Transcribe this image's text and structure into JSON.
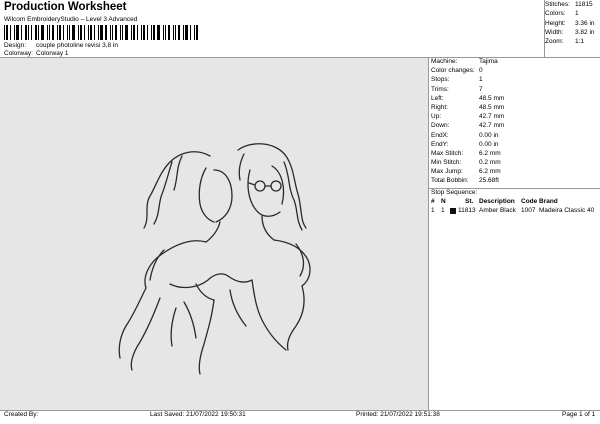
{
  "header": {
    "title": "Production Worksheet",
    "software": "Wilcom EmbroideryStudio – Level 3 Advanced",
    "design_label": "Design:",
    "design_value": "couple photoline revisi 3,8 in",
    "colorway_label": "Colorway:",
    "colorway_value": "Colorway 1"
  },
  "summary": [
    {
      "label": "Stitches:",
      "value": "11815"
    },
    {
      "label": "Colors:",
      "value": "1"
    },
    {
      "label": "Height:",
      "value": "3.36 in"
    },
    {
      "label": "Width:",
      "value": "3.82 in"
    },
    {
      "label": "Zoom:",
      "value": "1:1"
    }
  ],
  "machine_info": [
    {
      "label": "Machine:",
      "value": "Tajima"
    },
    {
      "label": "Color changes:",
      "value": "0"
    },
    {
      "label": "Stops:",
      "value": "1"
    },
    {
      "label": "Trims:",
      "value": "7"
    },
    {
      "label": "Left:",
      "value": "48.5 mm"
    },
    {
      "label": "Right:",
      "value": "48.5 mm"
    },
    {
      "label": "Up:",
      "value": "42.7 mm"
    },
    {
      "label": "Down:",
      "value": "42.7 mm"
    },
    {
      "label": "EndX:",
      "value": "0.00 in"
    },
    {
      "label": "EndY:",
      "value": "0.00 in"
    },
    {
      "label": "Max Stitch:",
      "value": "6.2 mm"
    },
    {
      "label": "Min Stitch:",
      "value": "0.2 mm"
    },
    {
      "label": "Max Jump:",
      "value": "6.2 mm"
    },
    {
      "label": "Total Bobbin:",
      "value": "25.68ft"
    }
  ],
  "stop_sequence": {
    "title": "Stop Sequence:",
    "headers": {
      "num": "#",
      "n": "N",
      "st": "St.",
      "desc": "Description",
      "code": "Code",
      "brand": "Brand"
    },
    "rows": [
      {
        "num": "1",
        "n": "1",
        "st": "11813",
        "desc": "Amber Black",
        "code": "1007",
        "brand": "Madeira Classic 40",
        "color": "#111111"
      }
    ]
  },
  "footer": {
    "created_by": "Created By:",
    "last_saved": "Last Saved: 21/07/2022 19:50:31",
    "printed": "Printed: 21/07/2022 19:51:38",
    "page": "Page 1 of 1"
  },
  "colors": {
    "canvas_bg": "#e6e6e6",
    "stitch": "#2a2a2a"
  }
}
